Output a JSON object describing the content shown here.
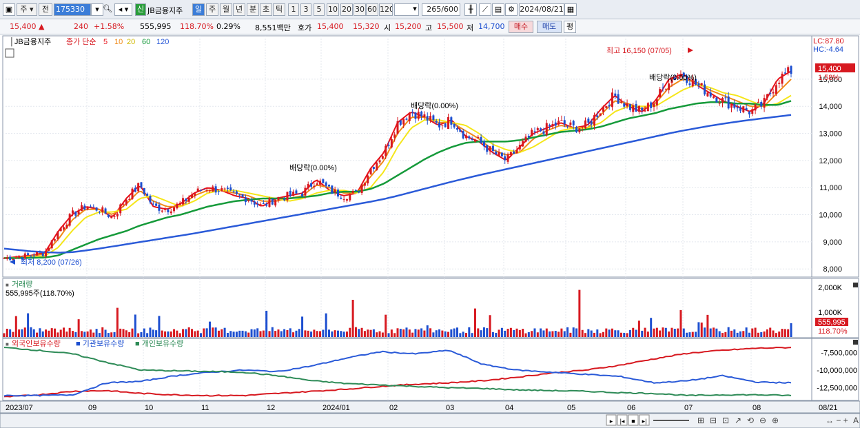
{
  "toolbar": {
    "tab_main": "주",
    "tab_prev": "전",
    "code": "175330",
    "new_badge": "신",
    "name": "JB금융지주",
    "period_day": "일",
    "period_week": "주",
    "period_month": "월",
    "period_year": "년",
    "period_min": "분",
    "period_sec": "초",
    "period_tick": "틱",
    "n_buttons": [
      "1",
      "3",
      "5",
      "10",
      "20",
      "30",
      "60",
      "120"
    ],
    "count": "265",
    "count_total": "/600",
    "date": "2024/08/21"
  },
  "quote": {
    "price": "15,400",
    "change": "240",
    "change_pct": "+1.58%",
    "volume": "555,995",
    "vol_ratio": "118.70%",
    "turnover": "0.29%",
    "amount": "8,551백만",
    "ask_label": "호가",
    "ask": "15,400",
    "bid": "15,320",
    "open_label": "시",
    "open": "15,200",
    "high_label": "고",
    "high": "15,500",
    "low_label": "저",
    "low": "14,700",
    "buy": "매수",
    "sell": "매도",
    "avg": "평"
  },
  "legend": {
    "name": "JB금융지주",
    "desc": "종가 단순",
    "ma": [
      "5",
      "10",
      "20",
      "60",
      "120"
    ],
    "lc": "LC:87.80",
    "hc": "HC:-4.64"
  },
  "annotations": {
    "high": "최고 16,150 (07/05)",
    "low": "최저 8,200 (07/26)",
    "div": "배당락(0.00%)"
  },
  "price_box": {
    "price": "15,400",
    "pct": "1.58%"
  },
  "volume": {
    "title": "거래량",
    "info": "555,995주(118.70%)",
    "y_labels": [
      "2,000K",
      "1,000K"
    ],
    "box": "555,995",
    "pct": "118.70%"
  },
  "holdings": {
    "foreign": "외국인보유수량",
    "inst": "기관보유수량",
    "indiv": "개인보유수량",
    "y_labels": [
      "-7,500,000",
      "-10,000,000",
      "-12,500,000"
    ]
  },
  "price_axis": [
    "15,000",
    "14,000",
    "13,000",
    "12,000",
    "11,000",
    "10,000",
    "9,000",
    "8,000"
  ],
  "x_axis": [
    "2023/07",
    "09",
    "10",
    "11",
    "12",
    "2024/01",
    "02",
    "03",
    "04",
    "05",
    "06",
    "07",
    "08",
    "08/21"
  ],
  "colors": {
    "up": "#d71920",
    "down": "#1d4fd0",
    "ma5": "#e8101a",
    "ma10": "#f08a18",
    "ma20": "#f5e61a",
    "ma60": "#159a3a",
    "ma120": "#2a5ad8"
  },
  "chart_data": {
    "type": "candlestick",
    "series": [
      {
        "name": "5",
        "values": [
          8400,
          8450,
          8500,
          8600,
          9400,
          10000,
          10300,
          10200,
          9900,
          10600,
          11100,
          10300,
          10200,
          10400,
          10800,
          11000,
          10900,
          10700,
          10600,
          10300,
          10600,
          10700,
          10800,
          11300,
          10900,
          10700,
          10800,
          11700,
          12300,
          13400,
          13800,
          13600,
          13300,
          13500,
          12900,
          12700,
          12300,
          12000,
          12500,
          13000,
          13200,
          13400,
          13200,
          13300,
          13900,
          14400,
          14000,
          13800,
          14200,
          15000,
          15200,
          14800,
          14500,
          14200,
          14000,
          13800,
          14100,
          15000,
          15300
        ]
      },
      {
        "name": "10",
        "values": [
          8400,
          8420,
          8480,
          8550,
          9100,
          9800,
          10200,
          10200,
          10000,
          10400,
          10900,
          10500,
          10300,
          10300,
          10700,
          10900,
          10900,
          10800,
          10700,
          10500,
          10500,
          10600,
          10700,
          11100,
          11000,
          10800,
          10800,
          11400,
          12000,
          13000,
          13600,
          13600,
          13400,
          13400,
          13100,
          12800,
          12400,
          12200,
          12300,
          12800,
          13100,
          13300,
          13200,
          13200,
          13700,
          14200,
          14100,
          13900,
          14100,
          14700,
          15000,
          14900,
          14600,
          14400,
          14200,
          14000,
          14000,
          14500,
          15000
        ]
      },
      {
        "name": "20",
        "values": [
          8400,
          8410,
          8430,
          8480,
          8800,
          9400,
          9900,
          10100,
          10100,
          10200,
          10600,
          10700,
          10500,
          10300,
          10500,
          10800,
          10900,
          10900,
          10800,
          10700,
          10600,
          10500,
          10600,
          10800,
          10900,
          10900,
          10800,
          11000,
          11600,
          12500,
          13200,
          13500,
          13500,
          13400,
          13300,
          13000,
          12600,
          12400,
          12300,
          12500,
          12800,
          13100,
          13200,
          13200,
          13400,
          13800,
          14000,
          14000,
          14000,
          14300,
          14600,
          14800,
          14700,
          14500,
          14400,
          14200,
          14000,
          14100,
          14400
        ]
      },
      {
        "name": "60",
        "values": [
          8400,
          8400,
          8410,
          8420,
          8500,
          8700,
          8900,
          9100,
          9250,
          9400,
          9600,
          9750,
          9900,
          10000,
          10150,
          10300,
          10400,
          10500,
          10550,
          10600,
          10600,
          10600,
          10650,
          10700,
          10800,
          10850,
          10850,
          10950,
          11150,
          11450,
          11750,
          12050,
          12300,
          12500,
          12650,
          12700,
          12700,
          12700,
          12750,
          12850,
          12950,
          13050,
          13100,
          13150,
          13250,
          13400,
          13550,
          13650,
          13750,
          13900,
          14000,
          14100,
          14150,
          14150,
          14100,
          14100,
          14050,
          14050,
          14200
        ]
      },
      {
        "name": "120",
        "values": [
          8750,
          8700,
          8650,
          8620,
          8600,
          8620,
          8680,
          8750,
          8830,
          8910,
          8990,
          9070,
          9150,
          9230,
          9310,
          9400,
          9490,
          9580,
          9670,
          9760,
          9850,
          9940,
          10030,
          10120,
          10210,
          10300,
          10390,
          10480,
          10580,
          10700,
          10830,
          10960,
          11090,
          11220,
          11340,
          11460,
          11570,
          11680,
          11790,
          11900,
          12010,
          12120,
          12230,
          12340,
          12450,
          12560,
          12670,
          12780,
          12890,
          13000,
          13100,
          13190,
          13280,
          13360,
          13430,
          13500,
          13560,
          13620,
          13680
        ]
      }
    ],
    "x": [
      "2023/07",
      "",
      "",
      "",
      "09",
      "",
      "10",
      "",
      "",
      "11",
      "",
      "",
      "12",
      "",
      "",
      "2024/01",
      "",
      "",
      "02",
      "",
      "",
      "03",
      "",
      "",
      "04",
      "",
      "",
      "05",
      "",
      "",
      "06",
      "",
      "",
      "07",
      "",
      "",
      "08",
      "",
      "08/21"
    ],
    "title": "",
    "xlabel": "",
    "ylabel": "",
    "ylim": [
      7700,
      16600
    ],
    "legend": "top-left"
  }
}
